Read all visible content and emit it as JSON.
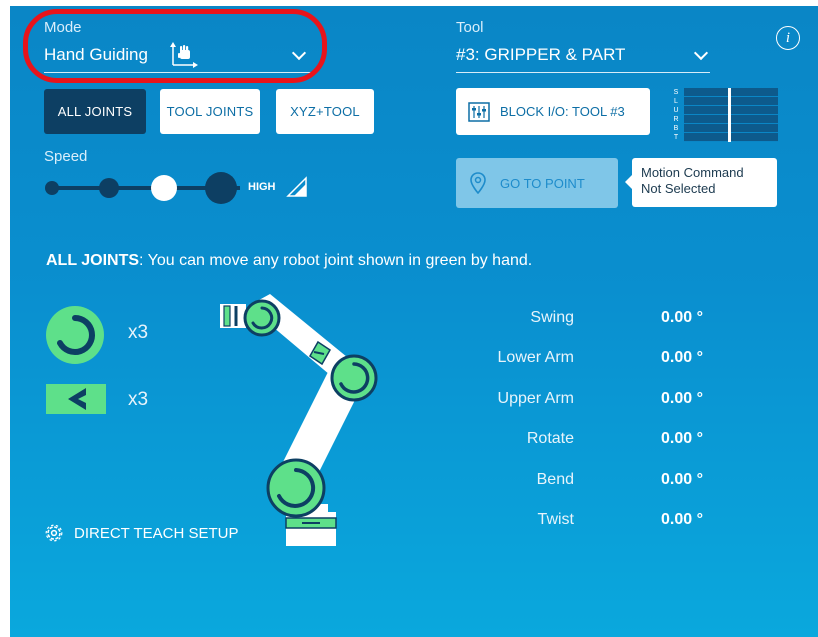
{
  "mode": {
    "label": "Mode",
    "value": "Hand Guiding"
  },
  "tool": {
    "label": "Tool",
    "value": "#3: GRIPPER & PART"
  },
  "tabs": [
    {
      "label": "ALL JOINTS",
      "active": true
    },
    {
      "label": "TOOL JOINTS",
      "active": false
    },
    {
      "label": "XYZ+TOOL",
      "active": false
    }
  ],
  "speed": {
    "label": "Speed",
    "level": "HIGH",
    "steps": 4,
    "selected_index": 2
  },
  "block_io": {
    "label": "BLOCK I/O: TOOL #3"
  },
  "io_rows": [
    "S",
    "L",
    "U",
    "R",
    "B",
    "T"
  ],
  "go_to_point": {
    "label": "GO TO POINT",
    "enabled": false
  },
  "motion_tooltip": {
    "line1": "Motion Command",
    "line2": "Not Selected"
  },
  "description": {
    "title": "ALL JOINTS",
    "text": ": You can move any robot joint shown in green by hand."
  },
  "legend": [
    {
      "icon": "rotary-joint-icon",
      "count": "x3"
    },
    {
      "icon": "linear-joint-icon",
      "count": "x3"
    }
  ],
  "joints": [
    {
      "name": "Swing",
      "value": "0.00 °"
    },
    {
      "name": "Lower Arm",
      "value": "0.00 °"
    },
    {
      "name": "Upper Arm",
      "value": "0.00 °"
    },
    {
      "name": "Rotate",
      "value": "0.00 °"
    },
    {
      "name": "Bend",
      "value": "0.00 °"
    },
    {
      "name": "Twist",
      "value": "0.00 °"
    }
  ],
  "direct_teach": {
    "label": "DIRECT TEACH SETUP"
  },
  "colors": {
    "active_green": "#5ee08a",
    "panel_blue": "#0a8fcf",
    "dark_navy": "#0d3f63",
    "highlight_red": "#e8141b"
  }
}
